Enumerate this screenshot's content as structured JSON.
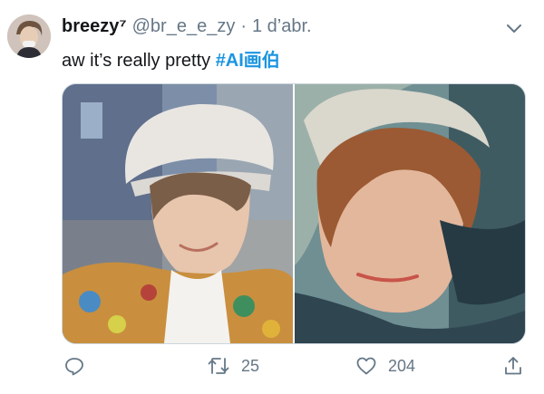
{
  "tweet": {
    "author": {
      "display_name": "breezy⁷",
      "handle": "@br_e_e_zy",
      "separator": "·",
      "time": "1 d’abr."
    },
    "text": {
      "plain": "aw it’s really pretty ",
      "hashtag": "#AI画伯"
    },
    "media": [
      {
        "alt": "selfie photo",
        "icon": "photo"
      },
      {
        "alt": "AI painting",
        "icon": "painting"
      }
    ],
    "actions": {
      "reply": {
        "icon": "reply-icon",
        "count": ""
      },
      "retweet": {
        "icon": "retweet-icon",
        "count": "25"
      },
      "like": {
        "icon": "heart-icon",
        "count": "204"
      },
      "share": {
        "icon": "share-icon",
        "count": ""
      }
    }
  },
  "colors": {
    "accent": "#1b95e0",
    "secondary_text": "#657786",
    "primary_text": "#14171a"
  }
}
